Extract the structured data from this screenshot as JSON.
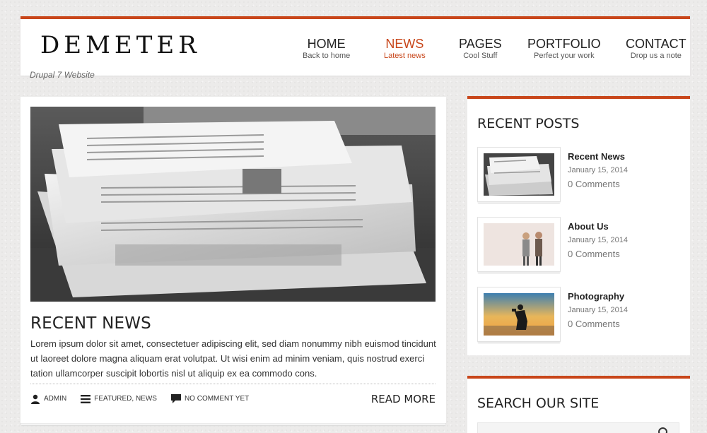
{
  "site": {
    "logo": "DEMETER",
    "tagline": "Drupal 7 Website"
  },
  "nav": {
    "items": [
      {
        "label": "HOME",
        "sub": "Back to home",
        "active": false
      },
      {
        "label": "NEWS",
        "sub": "Latest news",
        "active": true
      },
      {
        "label": "PAGES",
        "sub": "Cool Stuff",
        "active": false
      },
      {
        "label": "PORTFOLIO",
        "sub": "Perfect your work",
        "active": false
      },
      {
        "label": "CONTACT",
        "sub": "Drop us a note",
        "active": false
      }
    ]
  },
  "post": {
    "title": "RECENT NEWS",
    "excerpt": "Lorem ipsum dolor sit amet, consectetuer adipiscing elit, sed diam nonummy nibh euismod tincidunt ut laoreet dolore magna aliquam erat volutpat. Ut wisi enim ad minim veniam, quis nostrud exerci tation ullamcorper suscipit lobortis nisl ut aliquip ex ea commodo cons.",
    "author": "ADMIN",
    "categories": "FEATURED, NEWS",
    "comments": "NO COMMENT YET",
    "read_more": "READ MORE"
  },
  "sidebar": {
    "recent_title": "RECENT POSTS",
    "recent": [
      {
        "title": "Recent News",
        "date": "January 15, 2014",
        "comments": "0 Comments"
      },
      {
        "title": "About Us",
        "date": "January 15, 2014",
        "comments": "0 Comments"
      },
      {
        "title": "Photography",
        "date": "January 15, 2014",
        "comments": "0 Comments"
      }
    ],
    "search_title": "SEARCH OUR SITE"
  },
  "colors": {
    "accent": "#c8461a"
  }
}
